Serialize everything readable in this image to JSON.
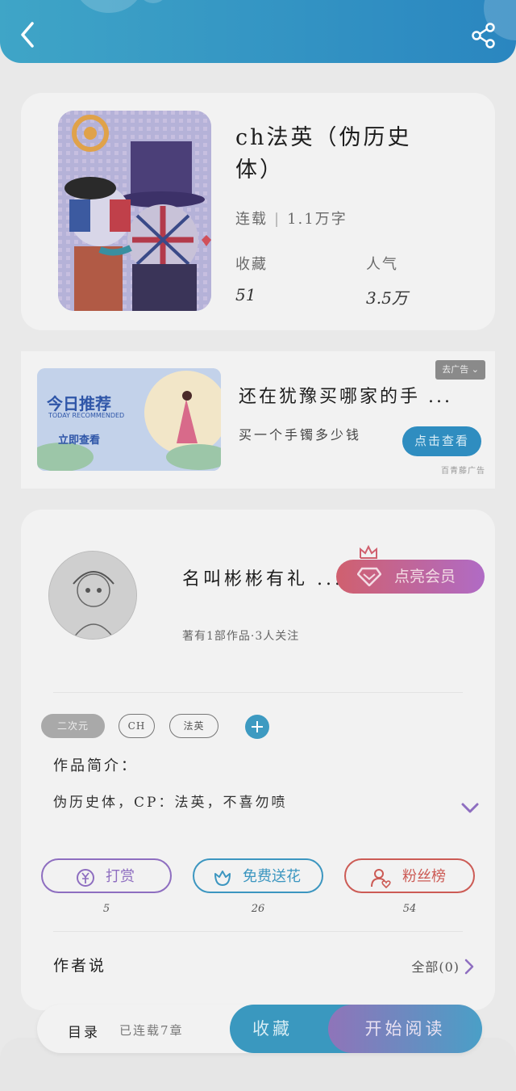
{
  "header": {
    "back_icon": "chevron-left-icon",
    "share_icon": "share-icon"
  },
  "book": {
    "title": "ch法英（伪历史体）",
    "status": "连载",
    "word_count": "1.1万字",
    "favorites_label": "收藏",
    "favorites_value": "51",
    "popularity_label": "人气",
    "popularity_value": "3.5万"
  },
  "ad": {
    "close_label": "去广告",
    "banner_title": "今日推荐",
    "banner_subtitle": "TODAY RECOMMENDED",
    "banner_cta": "立即查看",
    "title": "还在犹豫买哪家的手 ...",
    "description": "买一个手镯多少钱",
    "button_label": "点击查看",
    "source": "百青藤广告"
  },
  "author": {
    "name": "名叫彬彬有礼 ...",
    "stats": "著有1部作品·3人关注",
    "vip_button": "点亮会员"
  },
  "tags": [
    "二次元",
    "CH",
    "法英"
  ],
  "intro": {
    "label": "作品简介：",
    "text": "伪历史体，CP：法英，不喜勿喷"
  },
  "actions": [
    {
      "label": "打赏",
      "count": "5",
      "icon": "yen-icon",
      "color": "#8e6ec0"
    },
    {
      "label": "免费送花",
      "count": "26",
      "icon": "flower-icon",
      "color": "#3c96c0"
    },
    {
      "label": "粉丝榜",
      "count": "54",
      "icon": "fans-icon",
      "color": "#cc5b55"
    }
  ],
  "author_says": {
    "label": "作者说",
    "all_label": "全部(0)"
  },
  "bottom_bar": {
    "toc_label": "目录",
    "chapters": "已连载7章",
    "collect_label": "收藏",
    "read_label": "开始阅读"
  }
}
